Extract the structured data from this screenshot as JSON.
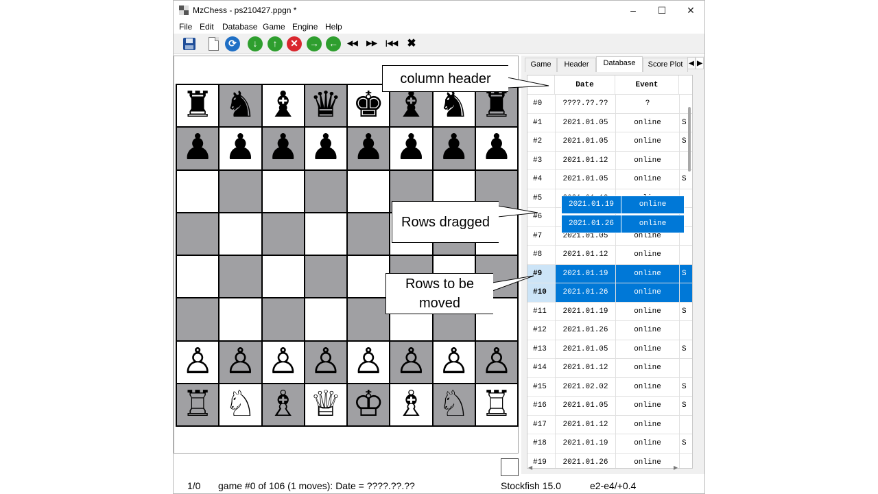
{
  "window": {
    "title": "MzChess - ps210427.ppgn *"
  },
  "window_controls": {
    "minimize": "–",
    "maximize": "☐",
    "close": "✕"
  },
  "menu": [
    "File",
    "Edit",
    "Database",
    "Game",
    "Engine",
    "Help"
  ],
  "toolbar": {
    "icons": [
      "save-icon",
      "new-file-icon",
      "refresh-icon",
      "down-arrow-icon",
      "up-arrow-icon",
      "stop-icon",
      "right-arrow-icon",
      "left-arrow-icon",
      "rewind-icon",
      "fast-forward-icon",
      "skip-first-icon",
      "tools-icon"
    ],
    "glyphs": {
      "down": "↓",
      "up": "↑",
      "stop": "✕",
      "right": "→",
      "left": "←",
      "rewind": "◀◀",
      "forward": "▶▶",
      "first": "|◀◀",
      "tools": "✖"
    },
    "colors": {
      "green": "#2e9e2e",
      "red": "#d9272e",
      "blue": "#1f6fc5"
    }
  },
  "board": {
    "light_color": "#ffffff",
    "dark_color": "#a0a0a3",
    "ranks": [
      [
        "♜",
        "♞",
        "♝",
        "♛",
        "♚",
        "♝",
        "♞",
        "♜"
      ],
      [
        "♟",
        "♟",
        "♟",
        "♟",
        "♟",
        "♟",
        "♟",
        "♟"
      ],
      [
        "",
        "",
        "",
        "",
        "",
        "",
        "",
        ""
      ],
      [
        "",
        "",
        "",
        "",
        "",
        "",
        "",
        ""
      ],
      [
        "",
        "",
        "",
        "",
        "",
        "",
        "",
        ""
      ],
      [
        "",
        "",
        "",
        "",
        "",
        "",
        "",
        ""
      ],
      [
        "♙",
        "♙",
        "♙",
        "♙",
        "♙",
        "♙",
        "♙",
        "♙"
      ],
      [
        "♖",
        "♘",
        "♗",
        "♕",
        "♔",
        "♗",
        "♘",
        "♖"
      ]
    ]
  },
  "tabs": [
    "Game",
    "Header",
    "Database",
    "Score Plot"
  ],
  "tab_arrows": {
    "left": "◀",
    "right": "▶"
  },
  "active_tab": "Database",
  "grid": {
    "headers": [
      "Date",
      "Event"
    ],
    "rows": [
      {
        "num": "#0",
        "date": "????.??.??",
        "event": "?",
        "extra": ""
      },
      {
        "num": "#1",
        "date": "2021.01.05",
        "event": "online",
        "extra": "S"
      },
      {
        "num": "#2",
        "date": "2021.01.05",
        "event": "online",
        "extra": "S"
      },
      {
        "num": "#3",
        "date": "2021.01.12",
        "event": "online",
        "extra": ""
      },
      {
        "num": "#4",
        "date": "2021.01.05",
        "event": "online",
        "extra": "S"
      },
      {
        "num": "#5",
        "date": "2021.01.12",
        "event": "online",
        "extra": ""
      },
      {
        "num": "#6",
        "date": "",
        "event": "",
        "extra": ""
      },
      {
        "num": "#7",
        "date": "2021.01.05",
        "event": "online",
        "extra": ""
      },
      {
        "num": "#8",
        "date": "2021.01.12",
        "event": "online",
        "extra": ""
      },
      {
        "num": "#9",
        "date": "2021.01.19",
        "event": "online",
        "extra": "S",
        "selected": true
      },
      {
        "num": "#10",
        "date": "2021.01.26",
        "event": "online",
        "extra": "",
        "selected": true
      },
      {
        "num": "#11",
        "date": "2021.01.19",
        "event": "online",
        "extra": "S"
      },
      {
        "num": "#12",
        "date": "2021.01.26",
        "event": "online",
        "extra": ""
      },
      {
        "num": "#13",
        "date": "2021.01.05",
        "event": "online",
        "extra": "S"
      },
      {
        "num": "#14",
        "date": "2021.01.12",
        "event": "online",
        "extra": ""
      },
      {
        "num": "#15",
        "date": "2021.02.02",
        "event": "online",
        "extra": "S"
      },
      {
        "num": "#16",
        "date": "2021.01.05",
        "event": "online",
        "extra": "S"
      },
      {
        "num": "#17",
        "date": "2021.01.12",
        "event": "online",
        "extra": ""
      },
      {
        "num": "#18",
        "date": "2021.01.19",
        "event": "online",
        "extra": "S"
      },
      {
        "num": "#19",
        "date": "2021.01.26",
        "event": "online",
        "extra": ""
      }
    ],
    "scroll_arrows": {
      "left": "◀",
      "right": "▶"
    },
    "selection_color": "#0078d7"
  },
  "drag_ghost": [
    {
      "date": "2021.01.19",
      "event": "online"
    },
    {
      "date": "2021.01.26",
      "event": "online"
    }
  ],
  "callouts": {
    "column_header": "column header",
    "rows_dragged": "Rows dragged",
    "rows_moved_line1": "Rows to be",
    "rows_moved_line2": "moved"
  },
  "status": {
    "counter": "1/0",
    "message": "game #0 of 106 (1 moves): Date = ????.??.??",
    "engine": "Stockfish 15.0",
    "eval": "e2-e4/+0.4"
  }
}
